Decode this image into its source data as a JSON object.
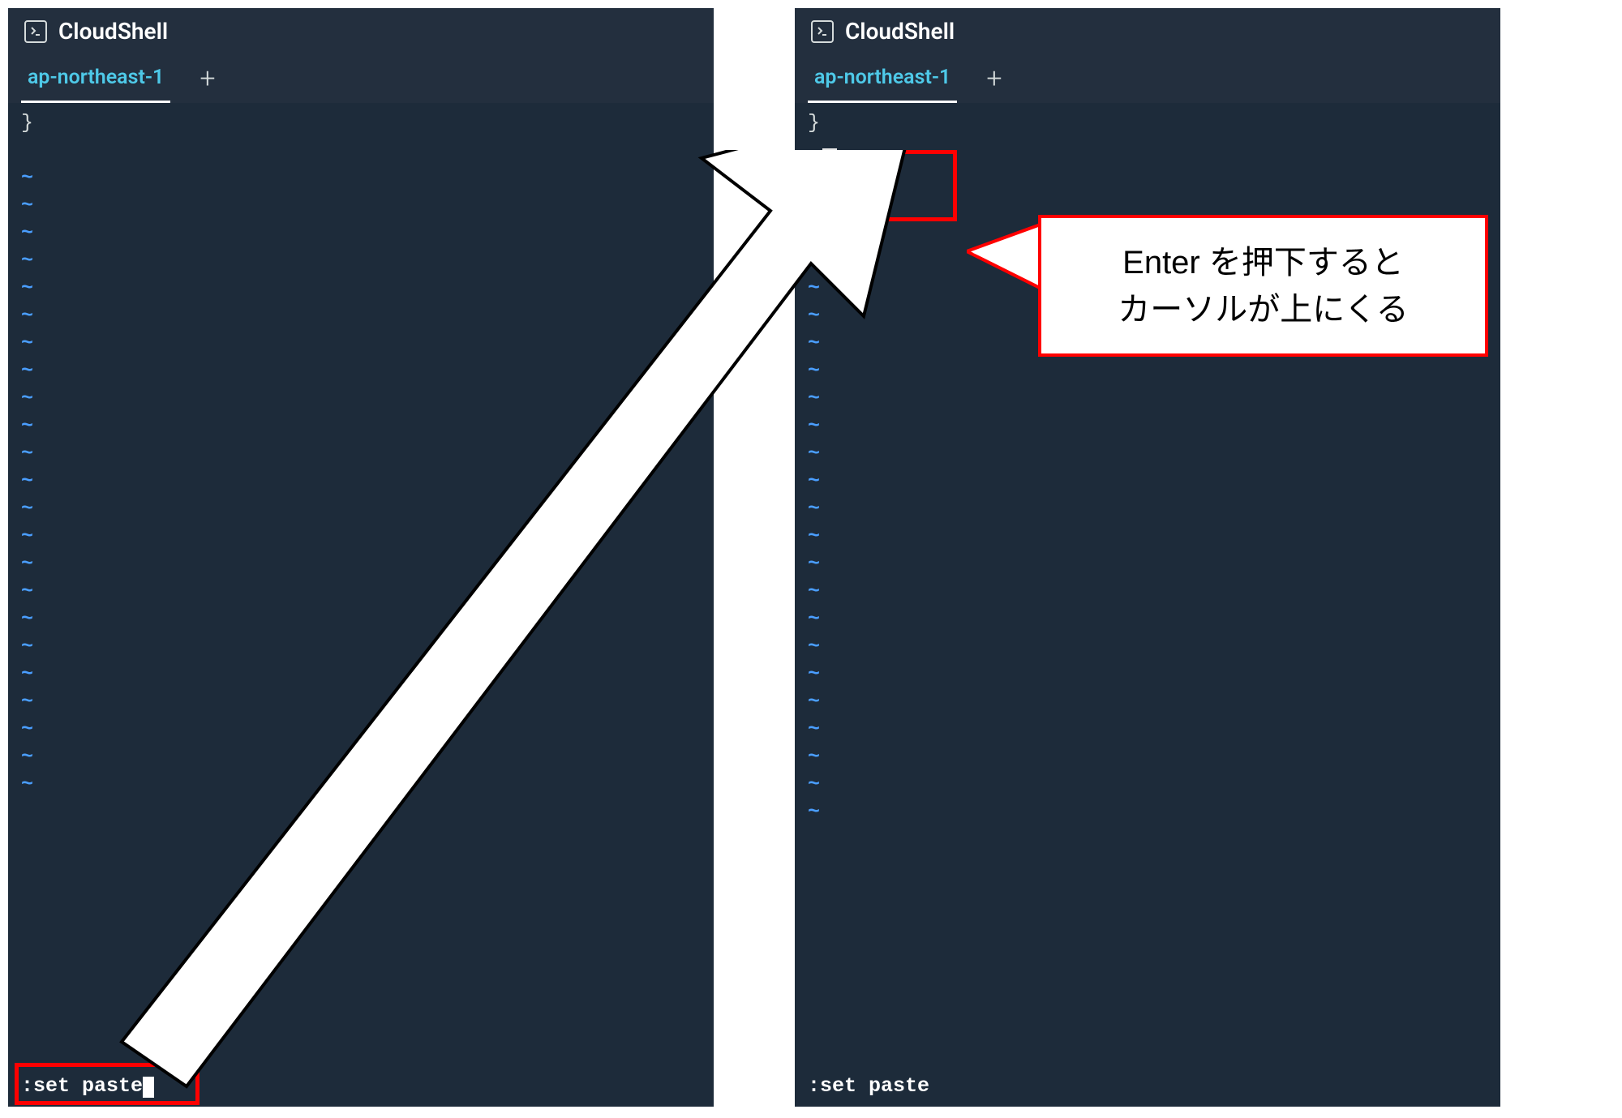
{
  "left": {
    "header": {
      "title": "CloudShell"
    },
    "tabs": {
      "active": "ap-northeast-1"
    },
    "terminal": {
      "first_line": "}",
      "command": ":set paste",
      "tilde_count": 23
    }
  },
  "right": {
    "header": {
      "title": "CloudShell"
    },
    "tabs": {
      "active": "ap-northeast-1"
    },
    "terminal": {
      "first_line": "}",
      "command": ":set paste",
      "tilde_count": 22
    }
  },
  "callout": {
    "line1": "Enter を押下すると",
    "line2": "カーソルが上にくる"
  }
}
